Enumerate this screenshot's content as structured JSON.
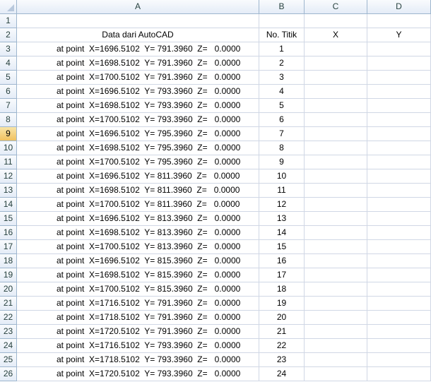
{
  "columns": [
    "A",
    "B",
    "C",
    "D"
  ],
  "rows": [
    {
      "num": "1",
      "a": "",
      "b": "",
      "c": "",
      "d": ""
    },
    {
      "num": "2",
      "a": "Data dari AutoCAD",
      "b": "No. Titik",
      "c": "X",
      "d": "Y"
    },
    {
      "num": "3",
      "a": "at point  X=1696.5102  Y= 791.3960  Z=   0.0000",
      "b": "1",
      "c": "",
      "d": ""
    },
    {
      "num": "4",
      "a": "at point  X=1698.5102  Y= 791.3960  Z=   0.0000",
      "b": "2",
      "c": "",
      "d": ""
    },
    {
      "num": "5",
      "a": "at point  X=1700.5102  Y= 791.3960  Z=   0.0000",
      "b": "3",
      "c": "",
      "d": ""
    },
    {
      "num": "6",
      "a": "at point  X=1696.5102  Y= 793.3960  Z=   0.0000",
      "b": "4",
      "c": "",
      "d": ""
    },
    {
      "num": "7",
      "a": "at point  X=1698.5102  Y= 793.3960  Z=   0.0000",
      "b": "5",
      "c": "",
      "d": ""
    },
    {
      "num": "8",
      "a": "at point  X=1700.5102  Y= 793.3960  Z=   0.0000",
      "b": "6",
      "c": "",
      "d": ""
    },
    {
      "num": "9",
      "a": "at point  X=1696.5102  Y= 795.3960  Z=   0.0000",
      "b": "7",
      "c": "",
      "d": ""
    },
    {
      "num": "10",
      "a": "at point  X=1698.5102  Y= 795.3960  Z=   0.0000",
      "b": "8",
      "c": "",
      "d": ""
    },
    {
      "num": "11",
      "a": "at point  X=1700.5102  Y= 795.3960  Z=   0.0000",
      "b": "9",
      "c": "",
      "d": ""
    },
    {
      "num": "12",
      "a": "at point  X=1696.5102  Y= 811.3960  Z=   0.0000",
      "b": "10",
      "c": "",
      "d": ""
    },
    {
      "num": "13",
      "a": "at point  X=1698.5102  Y= 811.3960  Z=   0.0000",
      "b": "11",
      "c": "",
      "d": ""
    },
    {
      "num": "14",
      "a": "at point  X=1700.5102  Y= 811.3960  Z=   0.0000",
      "b": "12",
      "c": "",
      "d": ""
    },
    {
      "num": "15",
      "a": "at point  X=1696.5102  Y= 813.3960  Z=   0.0000",
      "b": "13",
      "c": "",
      "d": ""
    },
    {
      "num": "16",
      "a": "at point  X=1698.5102  Y= 813.3960  Z=   0.0000",
      "b": "14",
      "c": "",
      "d": ""
    },
    {
      "num": "17",
      "a": "at point  X=1700.5102  Y= 813.3960  Z=   0.0000",
      "b": "15",
      "c": "",
      "d": ""
    },
    {
      "num": "18",
      "a": "at point  X=1696.5102  Y= 815.3960  Z=   0.0000",
      "b": "16",
      "c": "",
      "d": ""
    },
    {
      "num": "19",
      "a": "at point  X=1698.5102  Y= 815.3960  Z=   0.0000",
      "b": "17",
      "c": "",
      "d": ""
    },
    {
      "num": "20",
      "a": "at point  X=1700.5102  Y= 815.3960  Z=   0.0000",
      "b": "18",
      "c": "",
      "d": ""
    },
    {
      "num": "21",
      "a": "at point  X=1716.5102  Y= 791.3960  Z=   0.0000",
      "b": "19",
      "c": "",
      "d": ""
    },
    {
      "num": "22",
      "a": "at point  X=1718.5102  Y= 791.3960  Z=   0.0000",
      "b": "20",
      "c": "",
      "d": ""
    },
    {
      "num": "23",
      "a": "at point  X=1720.5102  Y= 791.3960  Z=   0.0000",
      "b": "21",
      "c": "",
      "d": ""
    },
    {
      "num": "24",
      "a": "at point  X=1716.5102  Y= 793.3960  Z=   0.0000",
      "b": "22",
      "c": "",
      "d": ""
    },
    {
      "num": "25",
      "a": "at point  X=1718.5102  Y= 793.3960  Z=   0.0000",
      "b": "23",
      "c": "",
      "d": ""
    },
    {
      "num": "26",
      "a": "at point  X=1720.5102  Y= 793.3960  Z=   0.0000",
      "b": "24",
      "c": "",
      "d": ""
    }
  ],
  "selected_row": "9"
}
